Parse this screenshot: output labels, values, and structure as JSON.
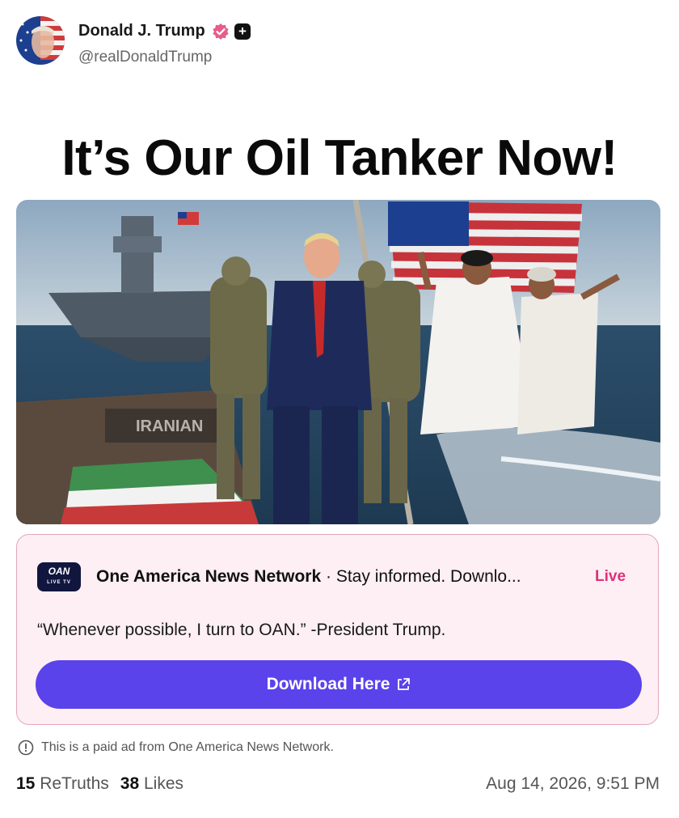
{
  "author": {
    "name": "Donald J. Trump",
    "handle": "@realDonaldTrump",
    "avatar_icon": "avatar-flag-portrait"
  },
  "post": {
    "headline": "It’s Our Oil Tanker Now!",
    "image_text": "IRANIAN",
    "image_icon": "photo-image"
  },
  "ad": {
    "logo_text": "OAN",
    "logo_subtext": "LIVE TV",
    "advertiser": "One America News Network",
    "tagline": " · Stay informed. Downlo...",
    "live_label": "Live",
    "quote": "“Whenever possible, I turn to OAN.” -President Trump.",
    "button_label": "Download Here",
    "button_icon": "external-link-icon"
  },
  "paid_notice": "This is a paid ad from One America News Network.",
  "stats": {
    "retruths_count": "15",
    "retruths_label": "ReTruths",
    "likes_count": "38",
    "likes_label": "Likes"
  },
  "timestamp": "Aug 14, 2026, 9:51 PM",
  "colors": {
    "verified": "#e85c8a",
    "button": "#5a43ea",
    "live": "#e0307a",
    "ad_bg": "#fdeff3"
  }
}
